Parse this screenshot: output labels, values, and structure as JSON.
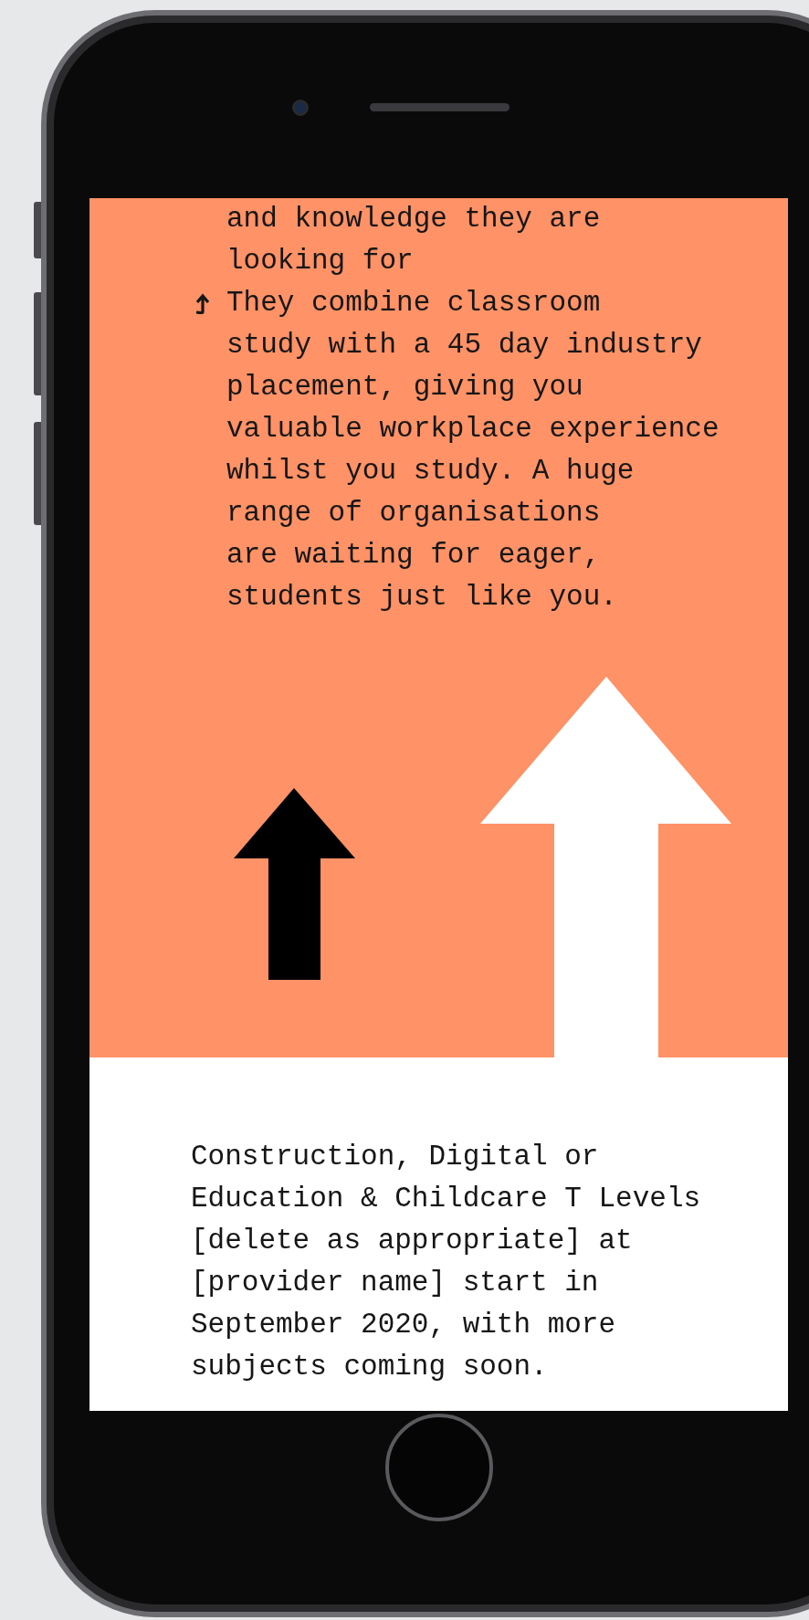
{
  "hero": {
    "list_items": [
      {
        "kind": "continuation",
        "text": "and knowledge they are\nlooking for"
      },
      {
        "kind": "bullet",
        "text": "They combine classroom\nstudy with a 45 day industry\nplacement, giving you\nvaluable workplace experience\nwhilst you study. A huge\nrange of organisations\nare waiting for eager,\nstudents just like you."
      }
    ]
  },
  "intro": {
    "paragraph": "Construction, Digital or Education & Childcare T Levels [delete as appropriate] at [provider name] start in September 2020, with more subjects coming soon."
  }
}
